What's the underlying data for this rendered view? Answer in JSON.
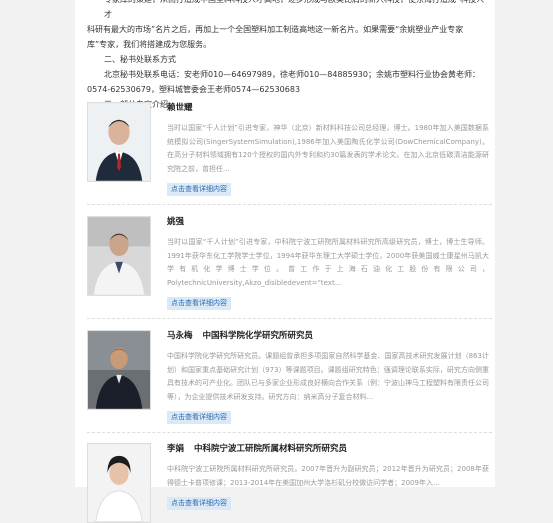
{
  "intro": {
    "line1": "专家库的策建，从而打造成中国塑料科技人才高地，逐步形成与欧美比肩的新兴科技，使东海打造成“科技人才",
    "line2": "科研有最大的市场”名片之后，再加上一个全国塑料加工制造高地这一新名片。如果需要“余姚塑业产业专家",
    "line3": "库”专家，我们将搭建成为您服务。",
    "section2_title": "二、秘书处联系方式",
    "contact_line1": "北京秘书处联系电话：安老师010—64697989，徐老师010—84885930；余姚市塑料行业协会黄老师：",
    "contact_line2": "0574-62530679，塑料城管委会王老师0574—62530683",
    "section3_title": "三、部分专家介绍"
  },
  "experts": [
    {
      "name": "赖世耀",
      "title": "",
      "bio": "当时以国家“千人计划”引进专家，神华（北京）新材料科技公司总经理，博士。1980年加入美国数据系统模拟公司(SingerSystemSimulation),1986年加入美国陶氏化学公司(DowChemicalCompany)。在高分子材料领域拥有120个授权的国内外专利和约30篇发表的学术论文。在加入北京低碳清洁能源研究院之前，曾担任...",
      "more": "点击查看详细内容"
    },
    {
      "name": "姚强",
      "title": "",
      "bio": "当时以国家“千人计划”引进专家，中科院宁波工研院所属材料研究所高级研究员，博士，博士生导师。1991年获华东化工学院学士学位，1994年获华东理工大学硕士学位，2000年获美国威士康星州马凯大学有机化学博士学位。曾工作于上海石油化工股份有限公司，PolytechnicUniversity,Akzo_disibledevent=\"text...",
      "more": "点击查看详细内容"
    },
    {
      "name": "马永梅",
      "title": "中国科学院化学研究所研究员",
      "bio": "中国科学院化学研究所研究员。课题组曾承担多项国家自然科学基金、国家高技术研究发展计划（863计划）和国家重点基础研究计划（973）等课题项目。课题组研究特色：强调理论联系实际，研究方向侧重具有技术的可产业化。团队已与多家企业形成良好横向合作关系（例：宁波山神马工程塑料有限责任公司等），为企业提供技术研发支持。研究方向：纳米高分子复合材料...",
      "more": "点击查看详细内容"
    },
    {
      "name": "李娟",
      "title": "中科院宁波工研院所属材料研究所研究员",
      "bio": "中科院宁波工研院所属材料研究所研究员。2007年晋升为副研究员；2012年晋升为研究员；2008年获得德士卡普项修课；2013-2014年在美国加州大学洛杉矶分校做访问学者；2009年入...",
      "more": "点击查看详细内容"
    }
  ]
}
